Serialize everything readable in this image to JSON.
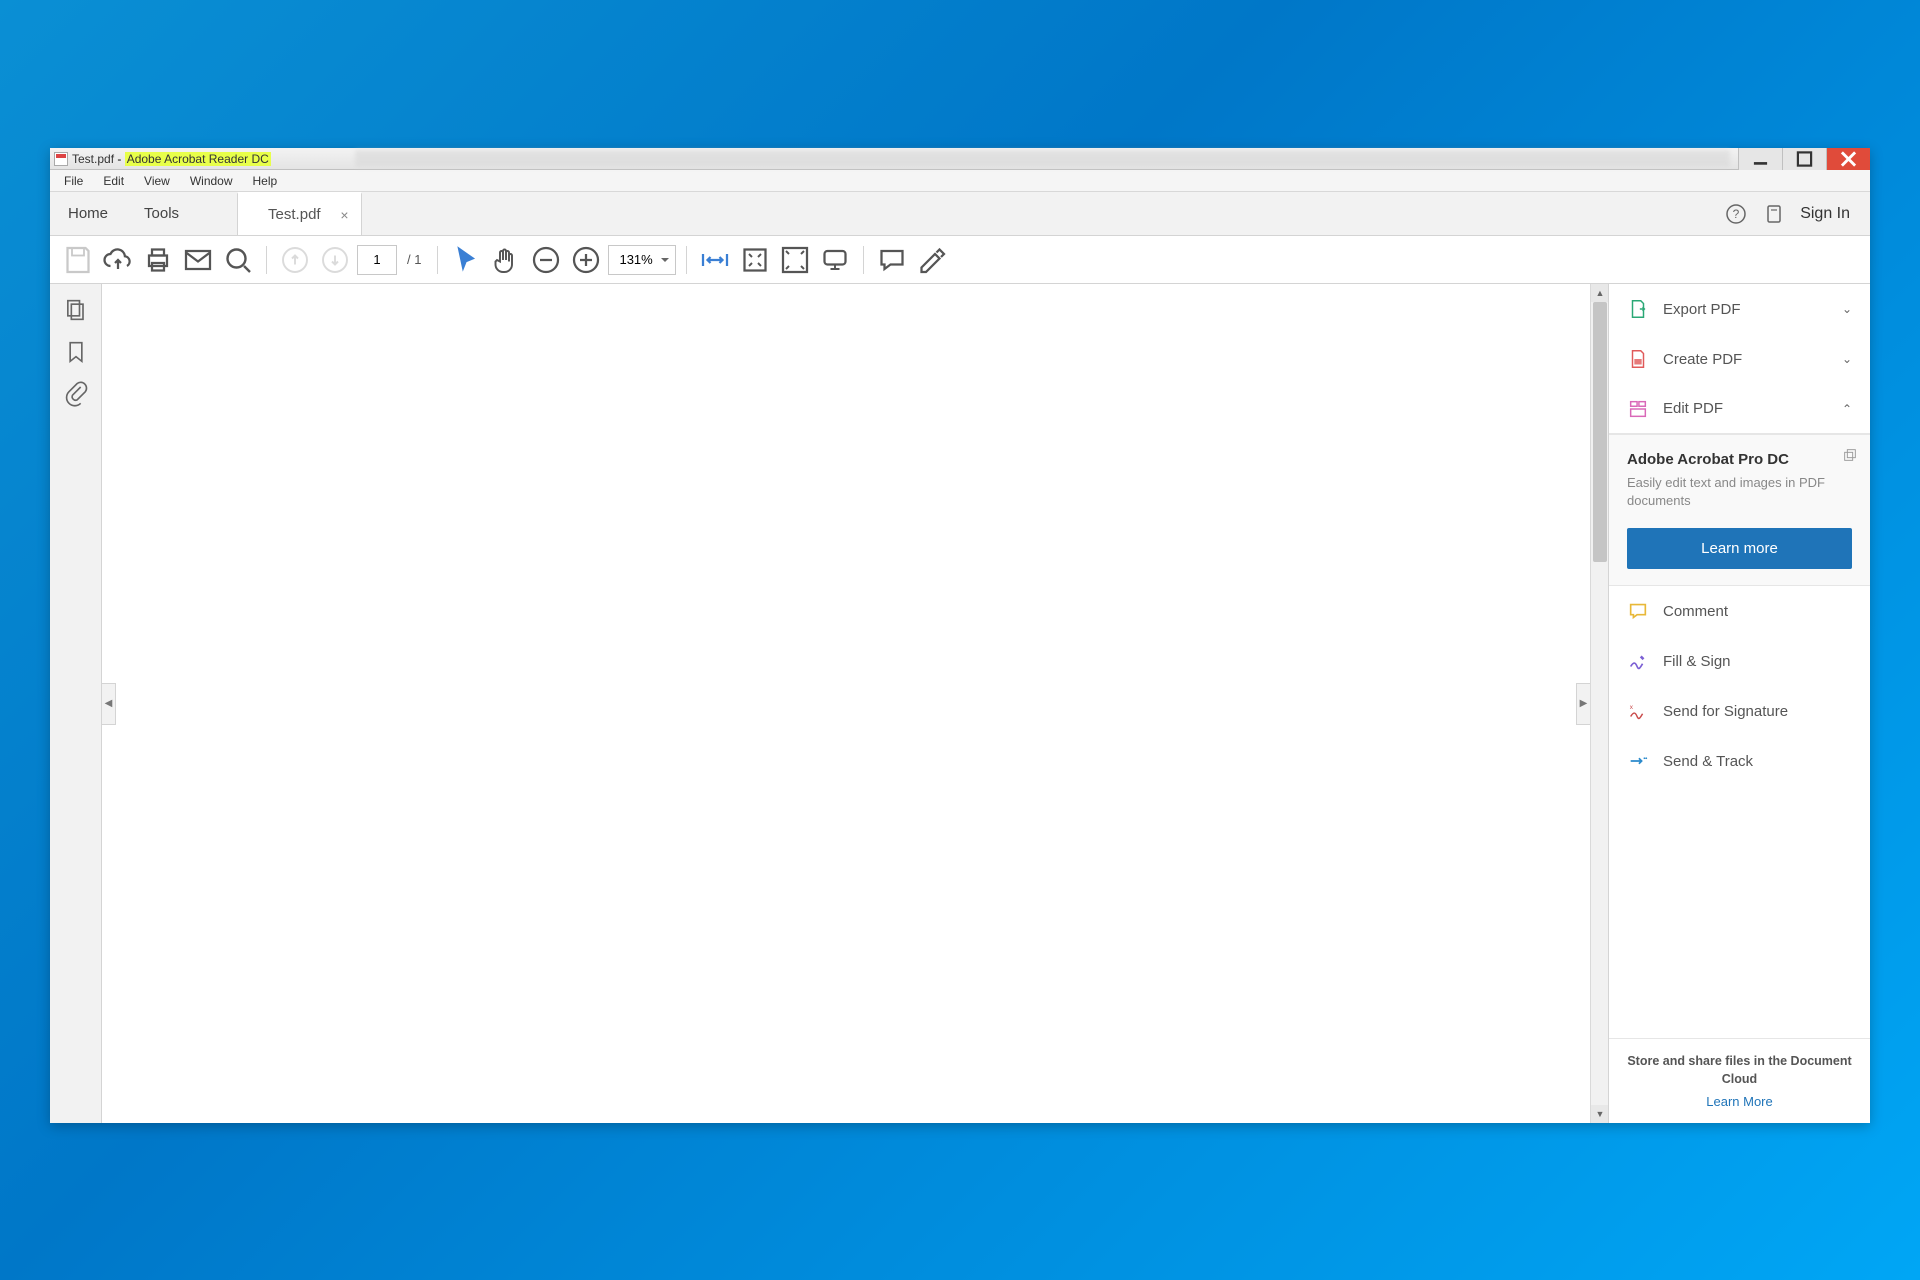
{
  "titlebar": {
    "file_name": "Test.pdf",
    "app_name": "Adobe Acrobat Reader DC"
  },
  "menubar": [
    "File",
    "Edit",
    "View",
    "Window",
    "Help"
  ],
  "tabbar": {
    "home": "Home",
    "tools": "Tools",
    "file_tab": "Test.pdf",
    "sign_in": "Sign In"
  },
  "toolbar": {
    "page_current": "1",
    "page_total": "1",
    "zoom": "131%"
  },
  "right_panel": {
    "export_pdf": "Export PDF",
    "create_pdf": "Create PDF",
    "edit_pdf": "Edit PDF",
    "promo_title": "Adobe Acrobat Pro DC",
    "promo_sub": "Easily edit text and images in PDF documents",
    "promo_button": "Learn more",
    "comment": "Comment",
    "fill_sign": "Fill & Sign",
    "send_sig": "Send for Signature",
    "send_track": "Send & Track",
    "cloud_title": "Store and share files in the Document Cloud",
    "cloud_link": "Learn More"
  }
}
